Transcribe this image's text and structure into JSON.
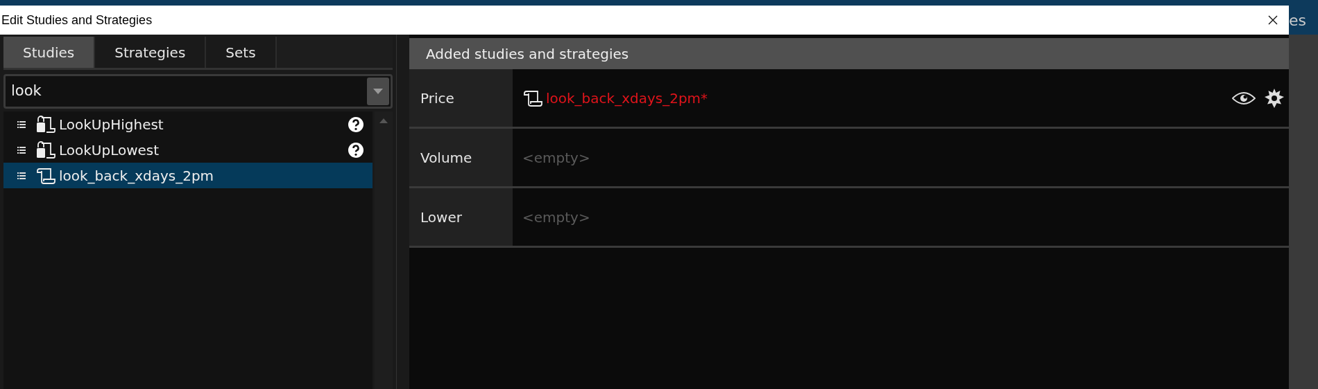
{
  "background": {
    "text": "es"
  },
  "window": {
    "title": "Edit Studies and Strategies"
  },
  "tabs": [
    {
      "label": "Studies",
      "selected": true
    },
    {
      "label": "Strategies",
      "selected": false
    },
    {
      "label": "Sets",
      "selected": false
    }
  ],
  "search": {
    "value": "look"
  },
  "results": [
    {
      "name": "LookUpHighest",
      "locked": true,
      "help": true,
      "selected": false
    },
    {
      "name": "LookUpLowest",
      "locked": true,
      "help": true,
      "selected": false
    },
    {
      "name": "look_back_xdays_2pm",
      "locked": false,
      "help": false,
      "selected": true
    }
  ],
  "added": {
    "title": "Added studies and strategies",
    "sections": [
      {
        "label": "Price",
        "studies": [
          {
            "name": "look_back_xdays_2pm*",
            "modified": true
          }
        ]
      },
      {
        "label": "Volume",
        "empty_text": "<empty>"
      },
      {
        "label": "Lower",
        "empty_text": "<empty>"
      }
    ]
  }
}
